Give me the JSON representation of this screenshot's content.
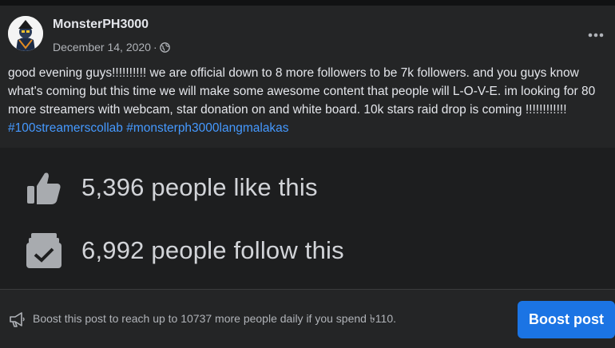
{
  "post": {
    "author": "MonsterPH3000",
    "date": "December 14, 2020",
    "meta_separator": "·",
    "privacy_icon": "globe-icon",
    "more_icon": "more-options-icon",
    "text_main": "good evening guys!!!!!!!!!! we are official down to 8 more followers to be 7k followers. and you guys know what's coming but this time we will make some awesome content that people will L-O-V-E. im looking for 80 more streamers with webcam, star donation on and white board. 10k stars raid drop is coming !!!!!!!!!!!! ",
    "hashtags": [
      "#100streamerscollab",
      "#monsterph3000langmalakas"
    ]
  },
  "stats": {
    "likes_text": "5,396 people like this",
    "likes_icon": "thumbs-up-icon",
    "follows_text": "6,992 people follow this",
    "follows_icon": "follow-checkbox-icon"
  },
  "boost": {
    "info_text": "Boost this post to reach up to 10737 more people daily if you spend ৳110.",
    "info_icon": "megaphone-icon",
    "button_label": "Boost post"
  },
  "colors": {
    "background": "#242526",
    "hashtag": "#4599ff",
    "button": "#1b74e4"
  }
}
